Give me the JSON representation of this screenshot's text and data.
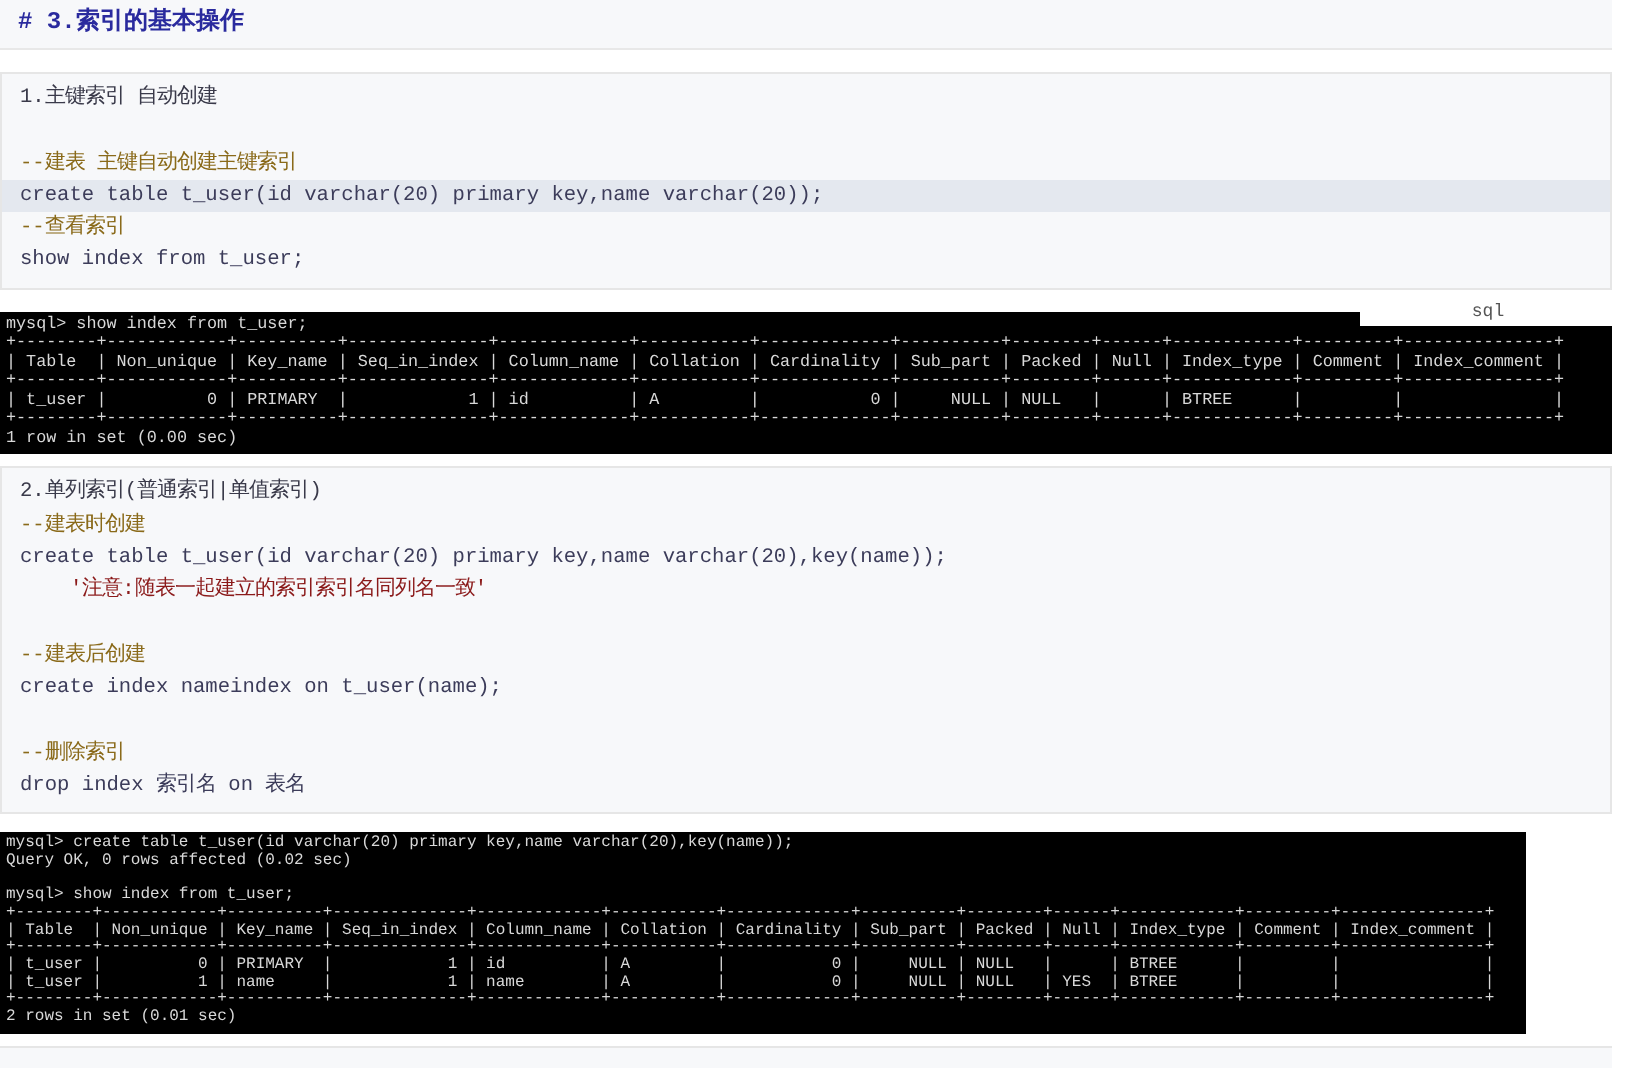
{
  "heading": "# 3.索引的基本操作",
  "blocks": [
    {
      "kind": "code",
      "lines": [
        {
          "kind": "text",
          "text": "1.主键索引 自动创建",
          "highlighted": false
        },
        {
          "kind": "blank"
        },
        {
          "kind": "comment",
          "text": "--建表 主键自动创建主键索引",
          "highlighted": false
        },
        {
          "kind": "code",
          "text": "create table t_user(id varchar(20) primary key,name varchar(20));",
          "highlighted": true
        },
        {
          "kind": "comment",
          "text": "--查看索引",
          "highlighted": false
        },
        {
          "kind": "code",
          "text": "show index from t_user;",
          "highlighted": false
        }
      ]
    },
    {
      "kind": "terminal",
      "language_label": "sql",
      "lines": [
        "mysql> show index from t_user;",
        "+--------+------------+----------+--------------+-------------+-----------+-------------+----------+--------+------+------------+---------+---------------+",
        "| Table  | Non_unique | Key_name | Seq_in_index | Column_name | Collation | Cardinality | Sub_part | Packed | Null | Index_type | Comment | Index_comment |",
        "+--------+------------+----------+--------------+-------------+-----------+-------------+----------+--------+------+------------+---------+---------------+",
        "| t_user |          0 | PRIMARY  |            1 | id          | A         |           0 |     NULL | NULL   |      | BTREE      |         |               |",
        "+--------+------------+----------+--------------+-------------+-----------+-------------+----------+--------+------+------------+---------+---------------+",
        "1 row in set (0.00 sec)"
      ]
    },
    {
      "kind": "code",
      "lines": [
        {
          "kind": "text",
          "text": "2.单列索引(普通索引|单值索引)",
          "highlighted": false
        },
        {
          "kind": "comment",
          "text": "--建表时创建",
          "highlighted": false
        },
        {
          "kind": "code",
          "text": "create table t_user(id varchar(20) primary key,name varchar(20),key(name));",
          "highlighted": false
        },
        {
          "kind": "string",
          "text": "'注意:随表一起建立的索引索引名同列名一致'",
          "highlighted": false
        },
        {
          "kind": "blank"
        },
        {
          "kind": "comment",
          "text": "--建表后创建",
          "highlighted": false
        },
        {
          "kind": "code",
          "text": "create index nameindex on t_user(name);",
          "highlighted": false
        },
        {
          "kind": "blank"
        },
        {
          "kind": "comment",
          "text": "--删除索引",
          "highlighted": false
        },
        {
          "kind": "code",
          "text": "drop index 索引名 on 表名",
          "highlighted": false
        }
      ]
    },
    {
      "kind": "terminal",
      "lines": [
        "mysql> create table t_user(id varchar(20) primary key,name varchar(20),key(name));",
        "Query OK, 0 rows affected (0.02 sec)",
        {
          "kind": "blank"
        },
        "mysql> show index from t_user;",
        "+--------+------------+----------+--------------+-------------+-----------+-------------+----------+--------+------+------------+---------+---------------+",
        "| Table  | Non_unique | Key_name | Seq_in_index | Column_name | Collation | Cardinality | Sub_part | Packed | Null | Index_type | Comment | Index_comment |",
        "+--------+------------+----------+--------------+-------------+-----------+-------------+----------+--------+------+------------+---------+---------------+",
        "| t_user |          0 | PRIMARY  |            1 | id          | A         |           0 |     NULL | NULL   |      | BTREE      |         |               |",
        "| t_user |          1 | name     |            1 | name        | A         |           0 |     NULL | NULL   | YES  | BTREE      |         |               |",
        "+--------+------------+----------+--------------+-------------+-----------+-------------+----------+--------+------+------------+---------+---------------+",
        "2 rows in set (0.01 sec)"
      ]
    }
  ]
}
